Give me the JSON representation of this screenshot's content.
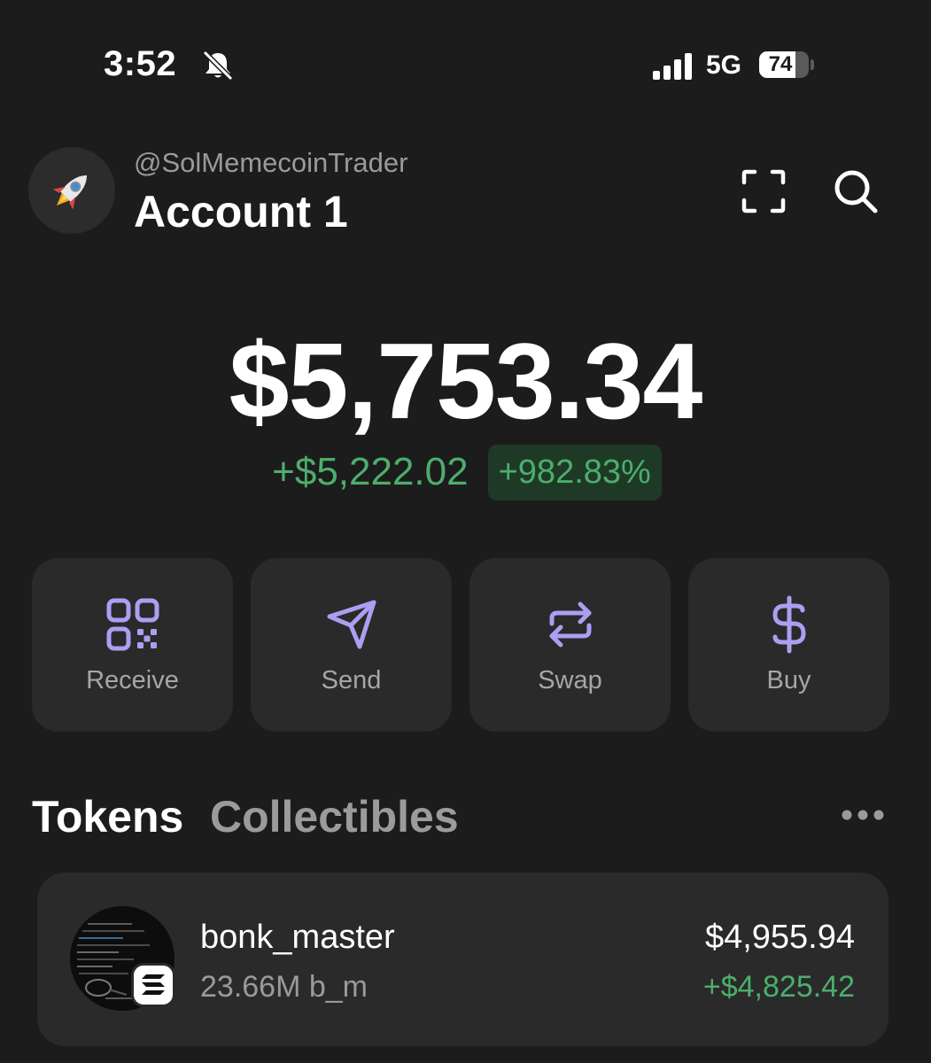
{
  "status_bar": {
    "time": "3:52",
    "network": "5G",
    "battery": "74",
    "battery_level": 0.74
  },
  "header": {
    "avatar_emoji": "🚀",
    "handle": "@SolMemecoinTrader",
    "account_name": "Account 1"
  },
  "balance": {
    "total": "$5,753.34",
    "change_amount": "+$5,222.02",
    "change_percent": "+982.83%"
  },
  "actions": [
    {
      "label": "Receive",
      "icon": "qr-code-icon"
    },
    {
      "label": "Send",
      "icon": "send-icon"
    },
    {
      "label": "Swap",
      "icon": "swap-icon"
    },
    {
      "label": "Buy",
      "icon": "dollar-icon"
    }
  ],
  "tabs": {
    "tokens": "Tokens",
    "collectibles": "Collectibles"
  },
  "tokens": [
    {
      "name": "bonk_master",
      "amount": "23.66M b_m",
      "value": "$4,955.94",
      "change": "+$4,825.42"
    }
  ],
  "colors": {
    "background": "#1c1c1c",
    "card": "#2a2a2a",
    "accent_purple": "#ab9ff2",
    "positive_green": "#4cae6c"
  }
}
